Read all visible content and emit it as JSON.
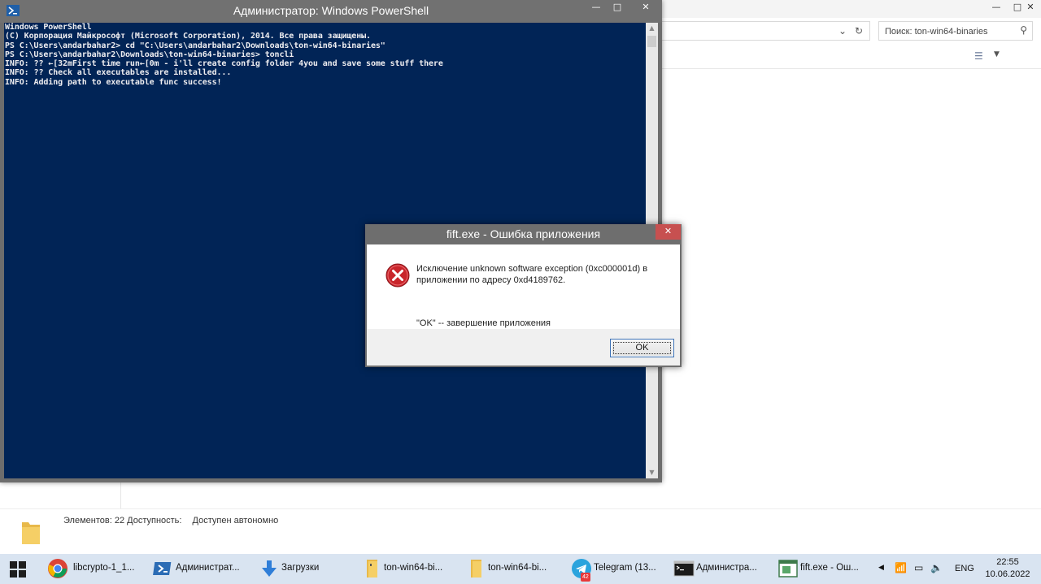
{
  "explorer": {
    "search_placeholder": "Поиск: ton-win64-binaries",
    "status": {
      "items_label": "Элементов:",
      "items_count": "22",
      "availability_label": "Доступность:",
      "availability_value": "Доступен автономно"
    }
  },
  "powershell": {
    "title": "Администратор: Windows PowerShell",
    "console_bg": "#012456",
    "lines": [
      "Windows PowerShell",
      "(C) Корпорация Майкрософт (Microsoft Corporation), 2014. Все права защищены.",
      "",
      "PS C:\\Users\\andarbahar2> cd \"C:\\Users\\andarbahar2\\Downloads\\ton-win64-binaries\"",
      "PS C:\\Users\\andarbahar2\\Downloads\\ton-win64-binaries> toncli",
      "INFO: ?? ←[32mFirst time run←[0m - i'll create config folder 4you and save some stuff there",
      "INFO: ?? Check all executables are installed...",
      "INFO: Adding path to executable func success!"
    ]
  },
  "dialog": {
    "title": "fift.exe - Ошибка приложения",
    "message_line1": "Исключение unknown software exception (0xc000001d) в",
    "message_line2": "приложении по адресу 0xd4189762.",
    "message_line3": "\"OK\" -- завершение приложения",
    "ok_label": "OK",
    "icon": "error-icon"
  },
  "taskbar": {
    "items": [
      {
        "label": "libcrypto-1_1...",
        "icon": "chrome-icon"
      },
      {
        "label": "Администрат...",
        "icon": "powershell-icon"
      },
      {
        "label": "Загрузки",
        "icon": "downloads-icon"
      },
      {
        "label": "ton-win64-bi...",
        "icon": "folder-icon"
      },
      {
        "label": "ton-win64-bi...",
        "icon": "folder-icon"
      },
      {
        "label": "Telegram (13...",
        "icon": "telegram-icon",
        "badge": "42"
      },
      {
        "label": "Администра...",
        "icon": "cmd-icon"
      },
      {
        "label": "fift.exe - Ош...",
        "icon": "app-window-icon"
      }
    ],
    "tray": {
      "language": "ENG",
      "time": "22:55",
      "date": "10.06.2022"
    }
  }
}
